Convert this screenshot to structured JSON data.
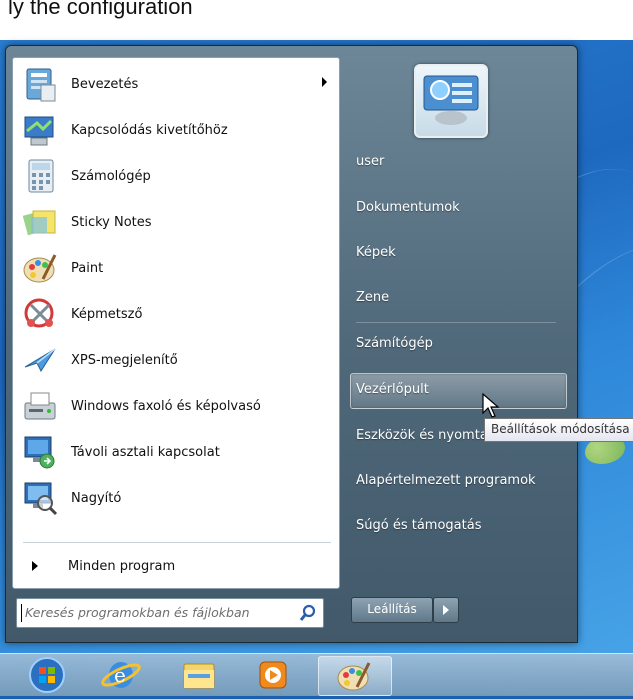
{
  "top_strip": {
    "text": "ly the configuration"
  },
  "start_menu": {
    "programs": [
      {
        "label": "Bevezetés",
        "icon": "getting-started-icon",
        "has_submenu": true
      },
      {
        "label": "Kapcsolódás kivetítőhöz",
        "icon": "projector-icon",
        "has_submenu": false
      },
      {
        "label": "Számológép",
        "icon": "calculator-icon",
        "has_submenu": false
      },
      {
        "label": "Sticky Notes",
        "icon": "sticky-notes-icon",
        "has_submenu": false
      },
      {
        "label": "Paint",
        "icon": "paint-palette-icon",
        "has_submenu": false
      },
      {
        "label": "Képmetsző",
        "icon": "snipping-tool-icon",
        "has_submenu": false
      },
      {
        "label": "XPS-megjelenítő",
        "icon": "xps-viewer-icon",
        "has_submenu": false
      },
      {
        "label": "Windows faxoló és képolvasó",
        "icon": "fax-scanner-icon",
        "has_submenu": false
      },
      {
        "label": "Távoli asztali kapcsolat",
        "icon": "remote-desktop-icon",
        "has_submenu": false
      },
      {
        "label": "Nagyító",
        "icon": "magnifier-icon",
        "has_submenu": false
      }
    ],
    "all_programs": "Minden program",
    "search_placeholder": "Keresés programokban és fájlokban",
    "right_links": [
      "user",
      "Dokumentumok",
      "Képek",
      "Zene",
      "Számítógép",
      "Vezérlőpult",
      "Eszközök és nyomtatók",
      "Alapértelmezett programok",
      "Súgó és támogatás"
    ],
    "highlighted_link": "Vezérlőpult",
    "shutdown_label": "Leállítás",
    "tooltip": "Beállítások módosítása"
  },
  "taskbar": {
    "items": [
      "start-orb-icon",
      "internet-explorer-icon",
      "file-explorer-icon",
      "media-player-icon",
      "paint-palette-icon"
    ],
    "active_item": "paint-palette-icon"
  }
}
